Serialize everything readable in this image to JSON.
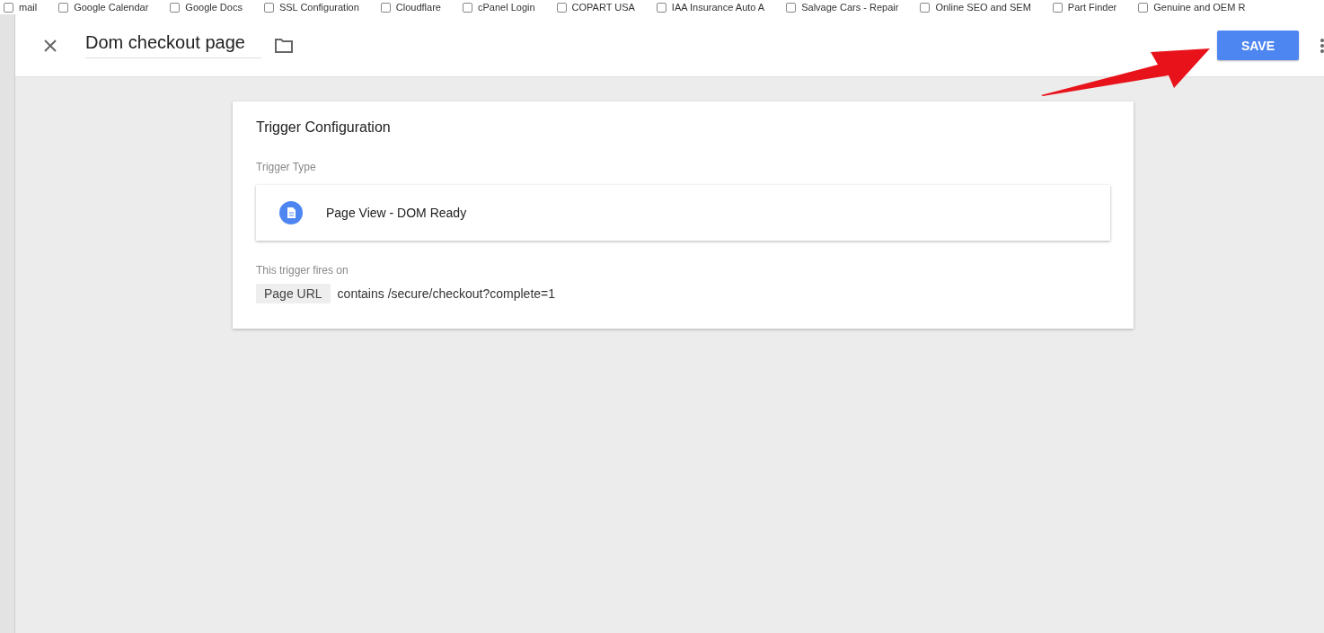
{
  "bookmarks": [
    {
      "label": "mail"
    },
    {
      "label": "Google Calendar"
    },
    {
      "label": "Google Docs"
    },
    {
      "label": "SSL Configuration"
    },
    {
      "label": "Cloudflare"
    },
    {
      "label": "cPanel Login"
    },
    {
      "label": "COPART USA"
    },
    {
      "label": "IAA Insurance Auto A"
    },
    {
      "label": "Salvage Cars - Repair"
    },
    {
      "label": "Online SEO and SEM"
    },
    {
      "label": "Part Finder"
    },
    {
      "label": "Genuine and OEM R"
    }
  ],
  "header": {
    "title": "Dom checkout page",
    "save_label": "SAVE"
  },
  "card": {
    "title": "Trigger Configuration",
    "type_label": "Trigger Type",
    "type_value": "Page View - DOM Ready",
    "fires_label": "This trigger fires on",
    "condition": {
      "variable": "Page URL",
      "rule": "contains /secure/checkout?complete=1"
    }
  }
}
